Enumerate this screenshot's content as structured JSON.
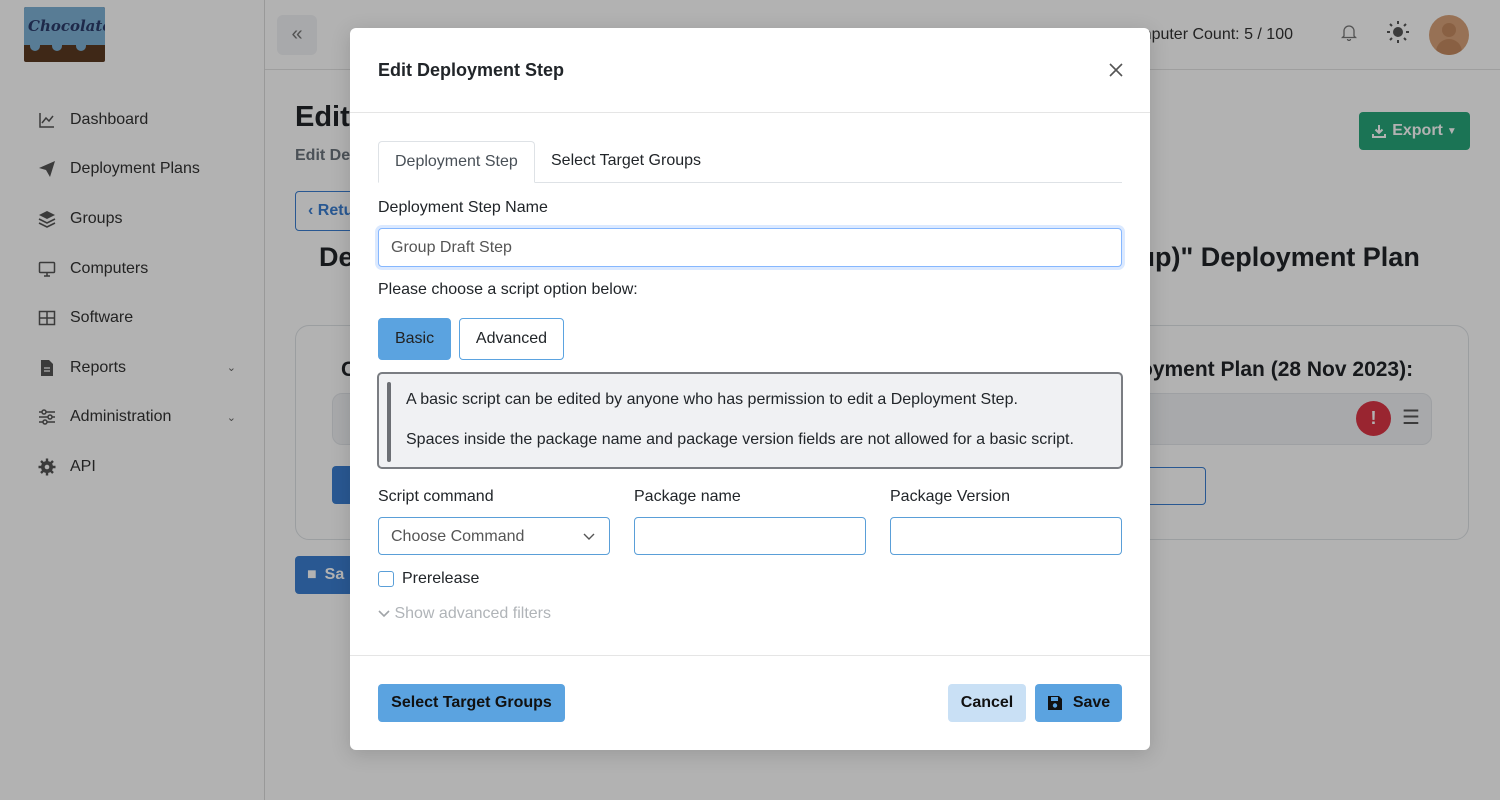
{
  "app": {
    "logo_text": "Chocolatey"
  },
  "sidebar": {
    "items": [
      {
        "label": "Dashboard",
        "icon": "chart-line-icon"
      },
      {
        "label": "Deployment Plans",
        "icon": "paper-plane-icon"
      },
      {
        "label": "Groups",
        "icon": "layers-icon"
      },
      {
        "label": "Computers",
        "icon": "monitor-icon"
      },
      {
        "label": "Software",
        "icon": "grid-icon"
      },
      {
        "label": "Reports",
        "icon": "file-icon",
        "expandable": true
      },
      {
        "label": "Administration",
        "icon": "sliders-icon",
        "expandable": true
      },
      {
        "label": "API",
        "icon": "gear-icon"
      }
    ]
  },
  "topbar": {
    "computer_count": "mputer Count: 5 / 100"
  },
  "page": {
    "title": "Edit",
    "subtitle": "Edit De",
    "export_label": "Export",
    "return_label": "Retu",
    "plan_heading_left": "De",
    "plan_heading_right": "oup)\" Deployment Plan",
    "card_title_left": "C",
    "card_title_right": "oyment Plan (28 Nov 2023):",
    "save_label": "Sa"
  },
  "modal": {
    "title": "Edit Deployment Step",
    "tabs": [
      {
        "label": "Deployment Step",
        "active": true
      },
      {
        "label": "Select Target Groups",
        "active": false
      }
    ],
    "step_name_label": "Deployment Step Name",
    "step_name_value": "Group Draft Step",
    "script_prompt": "Please choose a script option below:",
    "script_options": {
      "basic": "Basic",
      "advanced": "Advanced",
      "selected": "Basic"
    },
    "info_lines": [
      "A basic script can be edited by anyone who has permission to edit a Deployment Step.",
      "Spaces inside the package name and package version fields are not allowed for a basic script."
    ],
    "fields": {
      "script_command_label": "Script command",
      "script_command_value": "Choose Command",
      "package_name_label": "Package name",
      "package_name_value": "",
      "package_version_label": "Package Version",
      "package_version_value": ""
    },
    "prerelease_label": "Prerelease",
    "show_advanced_label": "Show advanced filters",
    "footer": {
      "select_target_label": "Select Target Groups",
      "cancel_label": "Cancel",
      "save_label": "Save"
    }
  },
  "colors": {
    "primary": "#5ba3e0",
    "export_green": "#28a77a",
    "alert_red": "#dc3545",
    "backdrop": "rgba(0,0,0,0.30)"
  }
}
